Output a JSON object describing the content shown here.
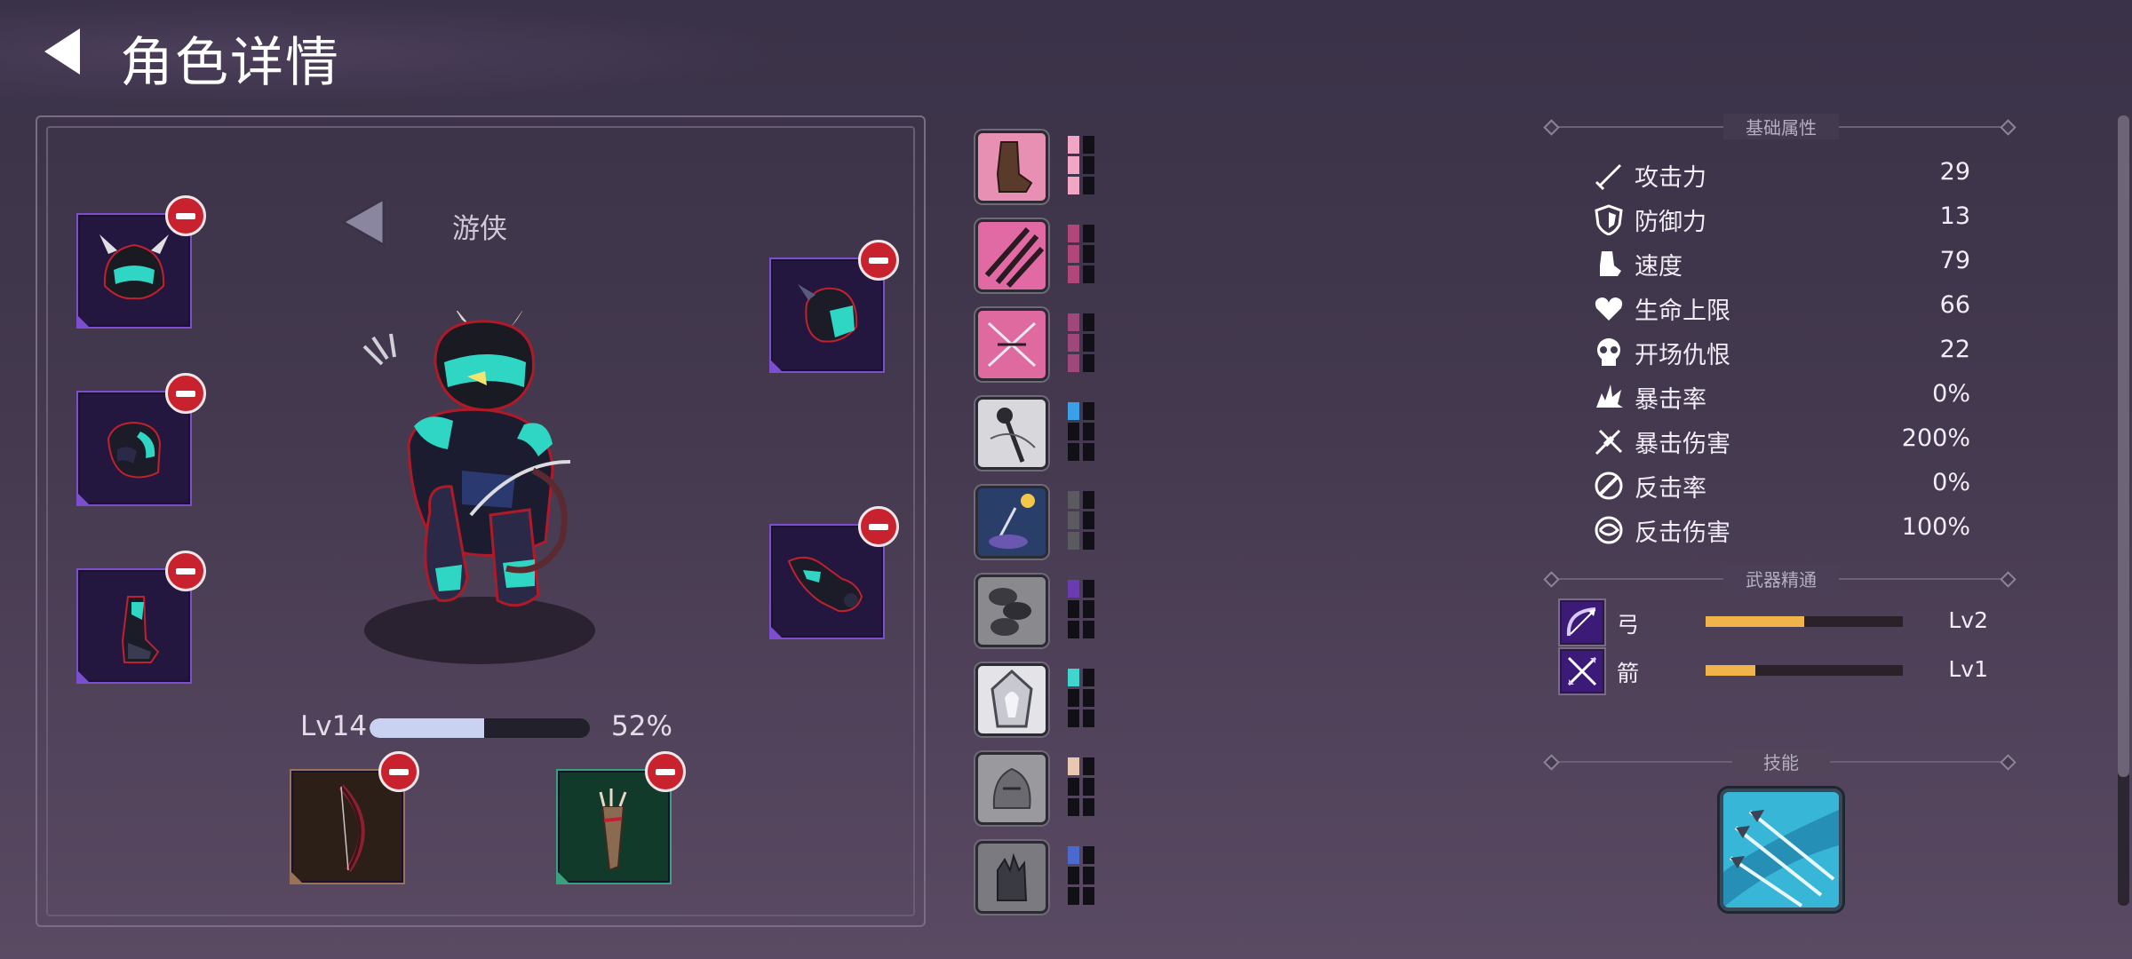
{
  "header": {
    "title": "角色详情",
    "back_icon": "back-arrow-icon"
  },
  "character": {
    "class_name": "游侠",
    "level_label": "Lv14",
    "exp_progress": 0.52,
    "exp_percent_text": "52%",
    "equipment": [
      {
        "slot": "helmet",
        "icon": "horned-helmet-icon",
        "rarity": "epic"
      },
      {
        "slot": "chest",
        "icon": "chest-armor-icon",
        "rarity": "epic"
      },
      {
        "slot": "boots",
        "icon": "boots-icon",
        "rarity": "epic"
      },
      {
        "slot": "shoulder",
        "icon": "shoulder-pad-icon",
        "rarity": "epic"
      },
      {
        "slot": "gloves",
        "icon": "gauntlet-icon",
        "rarity": "epic"
      },
      {
        "slot": "bow",
        "icon": "bow-icon",
        "rarity": "common"
      },
      {
        "slot": "quiver",
        "icon": "quiver-icon",
        "rarity": "uncommon"
      }
    ]
  },
  "traits": [
    {
      "icon": "boot-kick-icon",
      "color": "#f0a6c4",
      "filled": 3
    },
    {
      "icon": "claw-slash-icon",
      "color": "#b0467a",
      "filled": 3
    },
    {
      "icon": "crossed-arrows-icon",
      "color": "#a0487c",
      "filled": 3
    },
    {
      "icon": "staff-icon",
      "color": "#3aa0e8",
      "filled": 1
    },
    {
      "icon": "magic-bowl-icon",
      "color": "#5a5a60",
      "filled": 0
    },
    {
      "icon": "coins-icon",
      "color": "#6a3cb0",
      "filled": 1
    },
    {
      "icon": "ice-shield-icon",
      "color": "#3fd6d0",
      "filled": 1
    },
    {
      "icon": "stone-golem-icon",
      "color": "#e8c8b0",
      "filled": 1
    },
    {
      "icon": "hand-relic-icon",
      "color": "#4a6ad0",
      "filled": 1
    }
  ],
  "stats": {
    "section_title": "基础属性",
    "items": [
      {
        "icon": "sword-icon",
        "label": "攻击力",
        "value": "29"
      },
      {
        "icon": "shield-icon",
        "label": "防御力",
        "value": "13"
      },
      {
        "icon": "boot-icon",
        "label": "速度",
        "value": "79"
      },
      {
        "icon": "heart-icon",
        "label": "生命上限",
        "value": "66"
      },
      {
        "icon": "skull-icon",
        "label": "开场仇恨",
        "value": "22"
      },
      {
        "icon": "crit-burst-icon",
        "label": "暴击率",
        "value": "0%"
      },
      {
        "icon": "crit-slash-icon",
        "label": "暴击伤害",
        "value": "200%"
      },
      {
        "icon": "counter-icon",
        "label": "反击率",
        "value": "0%"
      },
      {
        "icon": "counter-damage-icon",
        "label": "反击伤害",
        "value": "100%"
      }
    ]
  },
  "weapon_mastery": {
    "section_title": "武器精通",
    "items": [
      {
        "icon": "bow-mastery-icon",
        "label": "弓",
        "progress": 0.5,
        "level": "Lv2"
      },
      {
        "icon": "arrow-mastery-icon",
        "label": "箭",
        "progress": 0.25,
        "level": "Lv1"
      }
    ]
  },
  "skills": {
    "section_title": "技能",
    "items": [
      {
        "icon": "arrow-volley-icon"
      }
    ]
  }
}
